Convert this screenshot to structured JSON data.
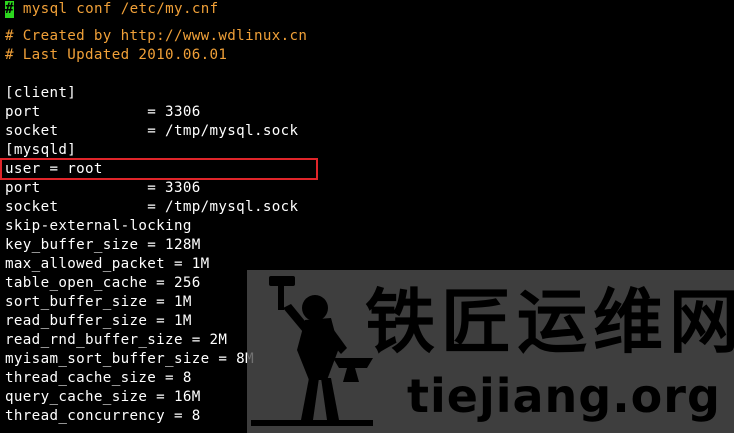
{
  "terminal": {
    "cursor_char": "#",
    "lines": [
      {
        "text": " mysql conf /etc/my.cnf",
        "kind": "comment"
      },
      {
        "text": "# Created by http://www.wdlinux.cn",
        "kind": "comment"
      },
      {
        "text": "# Last Updated 2010.06.01",
        "kind": "comment"
      },
      {
        "text": "",
        "kind": "text"
      },
      {
        "text": "[client]",
        "kind": "text"
      },
      {
        "text": "port            = 3306",
        "kind": "text"
      },
      {
        "text": "socket          = /tmp/mysql.sock",
        "kind": "text"
      },
      {
        "text": "[mysqld]",
        "kind": "text"
      },
      {
        "text": "user = root",
        "kind": "text"
      },
      {
        "text": "port            = 3306",
        "kind": "text"
      },
      {
        "text": "socket          = /tmp/mysql.sock",
        "kind": "text"
      },
      {
        "text": "skip-external-locking",
        "kind": "text"
      },
      {
        "text": "key_buffer_size = 128M",
        "kind": "text"
      },
      {
        "text": "max_allowed_packet = 1M",
        "kind": "text"
      },
      {
        "text": "table_open_cache = 256",
        "kind": "text"
      },
      {
        "text": "sort_buffer_size = 1M",
        "kind": "text"
      },
      {
        "text": "read_buffer_size = 1M",
        "kind": "text"
      },
      {
        "text": "read_rnd_buffer_size = 2M",
        "kind": "text"
      },
      {
        "text": "myisam_sort_buffer_size = 8M",
        "kind": "text"
      },
      {
        "text": "thread_cache_size = 8",
        "kind": "text"
      },
      {
        "text": "query_cache_size = 16M",
        "kind": "text"
      },
      {
        "text": "thread_concurrency = 8",
        "kind": "text"
      },
      {
        "text": "",
        "kind": "text"
      }
    ]
  },
  "watermark": {
    "title": "铁匠运维网",
    "url": "tiejiang.org"
  },
  "colors": {
    "background": "#000000",
    "text": "#ffffff",
    "comment": "#f0a038",
    "cursor": "#2cd81e",
    "highlight": "#e0252a"
  }
}
